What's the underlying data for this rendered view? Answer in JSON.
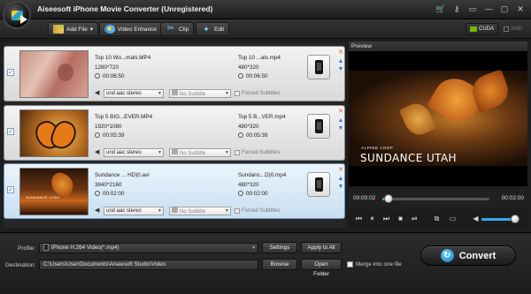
{
  "app": {
    "title": "Aiseesoft iPhone Movie Converter (Unregistered)",
    "titlebar_icons": [
      "cart-icon",
      "register-icon",
      "feedback-icon",
      "minimize-icon",
      "restore-icon",
      "close-icon"
    ],
    "titlebar_glyphs": [
      "🛒",
      "⚷",
      "▭",
      "—",
      "▢",
      "✕"
    ]
  },
  "toolbar": {
    "add_file": "Add File",
    "video_enhance": "Video Enhance",
    "clip": "Clip",
    "edit": "Edit",
    "gpu_cuda": "CUDA",
    "gpu_amd": "AMD"
  },
  "files": [
    {
      "src_name": "Top 10 Wo...mals.MP4",
      "src_res": "1280*720",
      "src_dur": "00:06:50",
      "dst_name": "Top 10 ...als.mp4",
      "dst_res": "480*320",
      "dst_dur": "00:06:50",
      "audio": "und aac stereo",
      "subtitle": "No Subtitle",
      "forced": "Forced Subtitles",
      "thumb_caption": ""
    },
    {
      "src_name": "Top 5 BIG...EVER.MP4",
      "src_res": "1920*1080",
      "src_dur": "00:05:39",
      "dst_name": "Top 5 B...VER.mp4",
      "dst_res": "480*320",
      "dst_dur": "00:05:39",
      "audio": "und aac stereo",
      "subtitle": "No Subtitle",
      "forced": "Forced Subtitles",
      "thumb_caption": ""
    },
    {
      "src_name": "Sundance ... HD)0.avi",
      "src_res": "3840*2160",
      "src_dur": "00:02:00",
      "dst_name": "Sundanc...D)0.mp4",
      "dst_res": "480*320",
      "dst_dur": "00:02:00",
      "audio": "und aac stereo",
      "subtitle": "No Subtitle",
      "forced": "Forced Subtitles",
      "thumb_caption": "SUNDANCE UTAH"
    }
  ],
  "preview": {
    "label": "Preview",
    "caption_small": "ALPINE LOOP",
    "caption_big": "SUNDANCE UTAH",
    "time_current": "00:00:02",
    "time_total": "00:02:00",
    "progress": 0.017,
    "volume": 0.8
  },
  "player": {
    "buttons": [
      "skip-back-icon",
      "pause-icon",
      "skip-forward-icon",
      "stop-icon",
      "next-frame-icon",
      "snapshot-icon",
      "open-folder-icon"
    ],
    "glyphs": [
      "⏮",
      "⏸",
      "⏭",
      "■",
      "⏯",
      "⧉",
      "▭"
    ]
  },
  "bottom": {
    "profile_label": "Profile:",
    "profile_value": "iPhone H.264 Video(*.mp4)",
    "settings": "Settings",
    "apply_to_all": "Apply to All",
    "destination_label": "Destination:",
    "destination_value": "C:\\Users\\User\\Documents\\Aiseesoft Studio\\Video",
    "browse": "Browse",
    "open_folder": "Open Folder",
    "merge": "Merge into one file",
    "convert": "Convert"
  },
  "colors": {
    "accent": "#38a6ec",
    "selected_row": "#c9dff1",
    "nvidia_green": "#76b900"
  }
}
